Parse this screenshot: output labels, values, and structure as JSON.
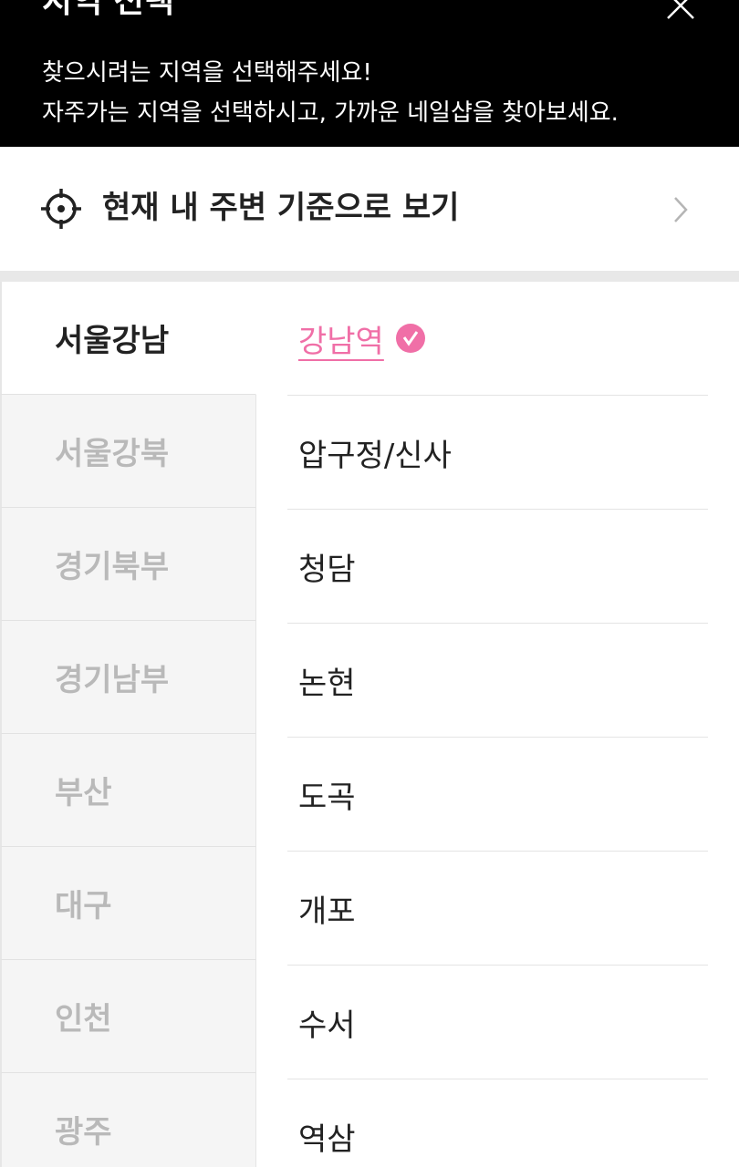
{
  "header": {
    "title": "지역 선택",
    "desc_line1": "찾으시려는 지역을 선택해주세요!",
    "desc_line2": "자주가는 지역을 선택하시고, 가까운 네일샵을 찾아보세요.",
    "close_icon": "close-icon"
  },
  "locate": {
    "label": "현재 내 주변 기준으로 보기",
    "icon": "crosshair-icon"
  },
  "regions": [
    {
      "label": "서울강남"
    },
    {
      "label": "서울강북"
    },
    {
      "label": "경기북부"
    },
    {
      "label": "경기남부"
    },
    {
      "label": "부산"
    },
    {
      "label": "대구"
    },
    {
      "label": "인천"
    },
    {
      "label": "광주"
    }
  ],
  "areas": [
    {
      "label": "강남역"
    },
    {
      "label": "압구정/신사"
    },
    {
      "label": "청담"
    },
    {
      "label": "논현"
    },
    {
      "label": "도곡"
    },
    {
      "label": "개포"
    },
    {
      "label": "수서"
    },
    {
      "label": "역삼"
    }
  ],
  "colors": {
    "accent": "#f06fa7",
    "header_bg": "#000000",
    "inactive_text": "#b9b9b9"
  }
}
